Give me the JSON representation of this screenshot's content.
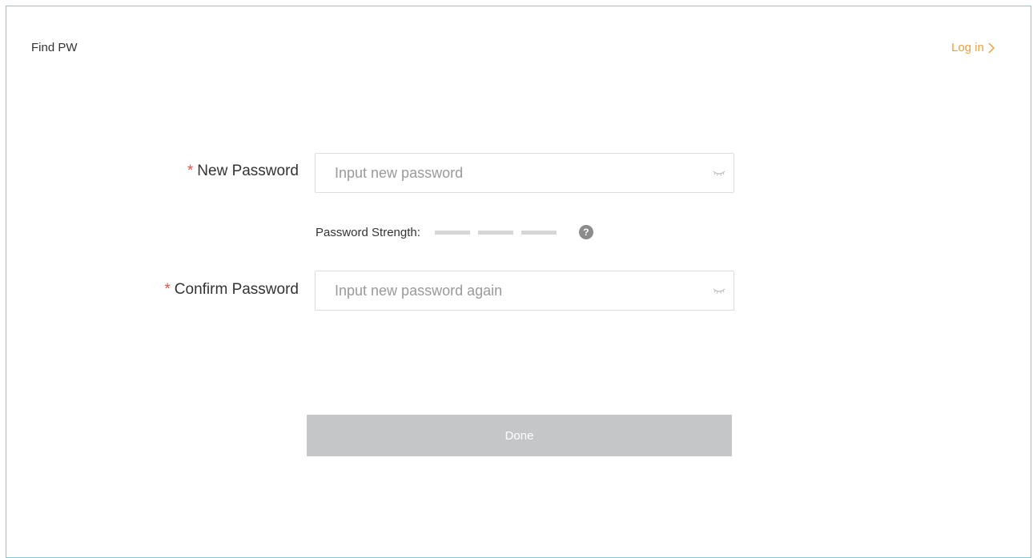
{
  "header": {
    "title": "Find PW",
    "login_label": "Log in",
    "login_icon": "chevron-right-icon"
  },
  "form": {
    "required_marker": "*",
    "new_password": {
      "label": "New Password",
      "placeholder": "Input new password",
      "value": "",
      "icon": "eye-closed-icon"
    },
    "strength": {
      "label": "Password Strength:",
      "level": 0,
      "levels_total": 3,
      "help_icon": "question-circle-icon",
      "help_glyph": "?"
    },
    "confirm_password": {
      "label": "Confirm Password",
      "placeholder": "Input new password again",
      "value": "",
      "icon": "eye-closed-icon"
    },
    "done_label": "Done",
    "done_enabled": false
  },
  "colors": {
    "accent": "#e9a23b",
    "required": "#e2564a",
    "frame_border": "#86c7d1",
    "button_disabled": "#c4c6c8",
    "strength_empty": "#d6d6d6"
  }
}
